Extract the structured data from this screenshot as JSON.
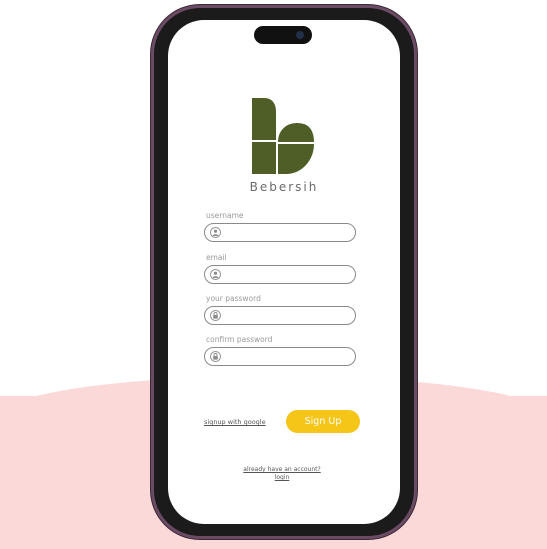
{
  "brand": {
    "name": "Bebersih",
    "logo_color": "#4f5e26"
  },
  "form": {
    "username": {
      "label": "username",
      "icon": "user-icon"
    },
    "email": {
      "label": "email",
      "icon": "user-icon"
    },
    "password": {
      "label": "your password",
      "icon": "lock-icon"
    },
    "confirm": {
      "label": "confirm password",
      "icon": "lock-icon"
    }
  },
  "actions": {
    "google_label": "signup with google",
    "signup_label": "Sign Up",
    "signup_color": "#f5c518",
    "account_question": "already have an account?",
    "login_label": "login"
  },
  "colors": {
    "background_band": "#fbd9d9",
    "phone_frame": "#6b4b63"
  }
}
